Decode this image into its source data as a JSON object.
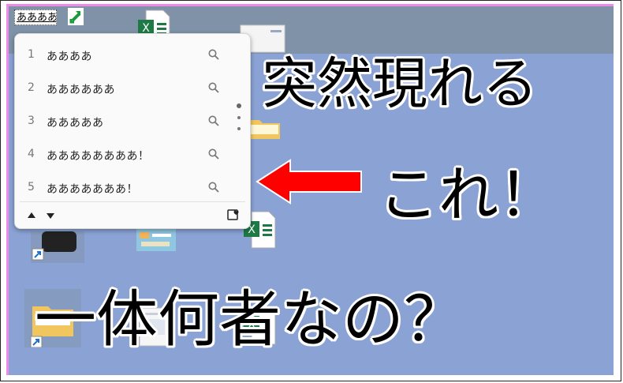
{
  "ime": {
    "composition_text": "ああああ"
  },
  "candidates": [
    {
      "num": "1",
      "text": "ああああ"
    },
    {
      "num": "2",
      "text": "ああああああ"
    },
    {
      "num": "3",
      "text": "あああああ"
    },
    {
      "num": "4",
      "text": "ああああああああ！"
    },
    {
      "num": "5",
      "text": "あああああああ！"
    }
  ],
  "caption": {
    "line1": "突然現れる",
    "line2": "これ！",
    "line3": "一体何者なの？"
  },
  "colors": {
    "desktop_bg": "#8aa2d4",
    "arrow": "#ff0000",
    "frame_accent": "#f08ae8"
  },
  "icons": [
    "ime-mode-icon",
    "search-icon",
    "favorite-icon",
    "excel-file-icon",
    "folder-icon",
    "shortcut-arrow-icon"
  ]
}
